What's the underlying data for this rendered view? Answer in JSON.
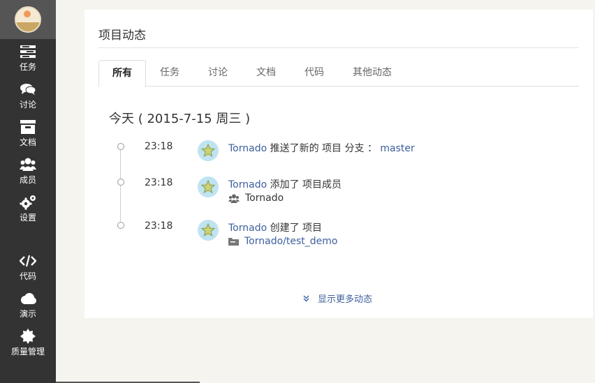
{
  "sidebar": {
    "items": [
      {
        "label": "任务",
        "icon": "tasks-icon"
      },
      {
        "label": "讨论",
        "icon": "chat-bubbles-icon"
      },
      {
        "label": "文档",
        "icon": "archive-box-icon"
      },
      {
        "label": "成员",
        "icon": "users-icon"
      },
      {
        "label": "设置",
        "icon": "gears-icon"
      },
      {
        "label": "代码",
        "icon": "code-icon"
      },
      {
        "label": "演示",
        "icon": "cloud-icon"
      },
      {
        "label": "质量管理",
        "icon": "badge-icon"
      }
    ]
  },
  "panel": {
    "title": "项目动态",
    "tabs": [
      "所有",
      "任务",
      "讨论",
      "文档",
      "代码",
      "其他动态"
    ],
    "active_tab": "所有",
    "day_header": "今天 ( 2015-7-15 周三 )",
    "events": [
      {
        "time": "23:18",
        "user": "Tornado",
        "action": "推送了新的 项目 分支 ：",
        "target": "master"
      },
      {
        "time": "23:18",
        "user": "Tornado",
        "action": "添加了 项目成员",
        "detail": "Tornado",
        "detail_icon": "users-icon"
      },
      {
        "time": "23:18",
        "user": "Tornado",
        "action": "创建了 项目",
        "detail": "Tornado/test_demo",
        "detail_icon": "folder-icon"
      }
    ],
    "more_label": "显示更多动态"
  },
  "colors": {
    "sidebar_bg": "#333333",
    "link": "#3d5f9e",
    "page_bg": "#f5f4ef"
  }
}
